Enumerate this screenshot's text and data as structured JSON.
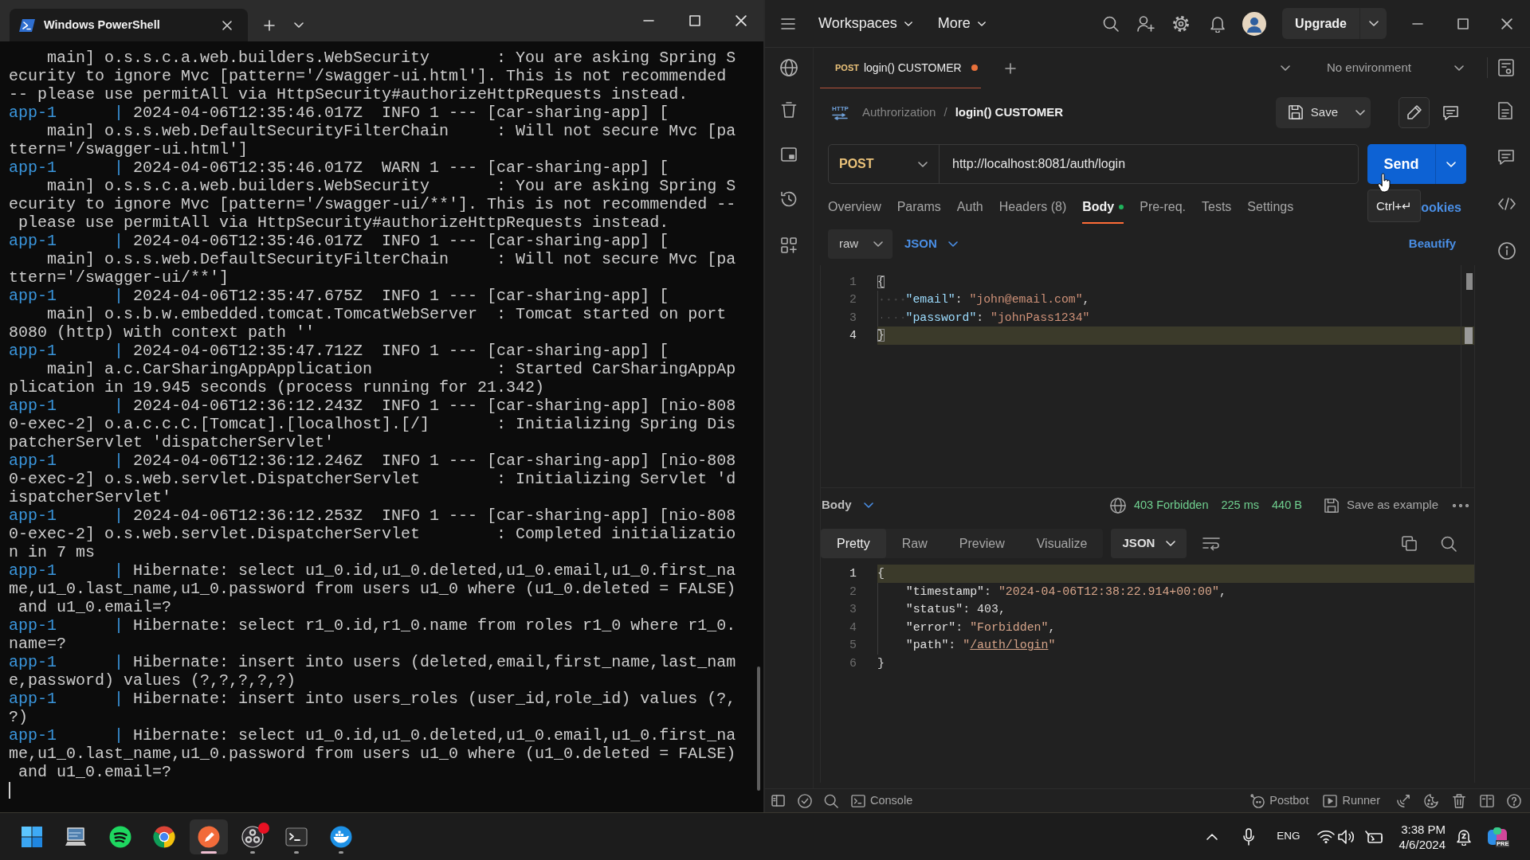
{
  "terminal": {
    "tab_title": "Windows PowerShell",
    "lines": [
      {
        "kind": "wrap",
        "text": "    main] o.s.s.c.a.web.builders.WebSecurity       : You are asking Spring S"
      },
      {
        "kind": "wrap",
        "text": "ecurity to ignore Mvc [pattern='/swagger-ui.html']. This is not recommended"
      },
      {
        "kind": "wrap",
        "text": "-- please use permitAll via HttpSecurity#authorizeHttpRequests instead."
      },
      {
        "kind": "log",
        "prefix": "app-1      |",
        "text": "2024-04-06T12:35:46.017Z  INFO 1 --- [car-sharing-app] ["
      },
      {
        "kind": "wrap",
        "text": "    main] o.s.s.web.DefaultSecurityFilterChain     : Will not secure Mvc [pa"
      },
      {
        "kind": "wrap",
        "text": "ttern='/swagger-ui.html']"
      },
      {
        "kind": "log",
        "prefix": "app-1      |",
        "text": "2024-04-06T12:35:46.017Z  WARN 1 --- [car-sharing-app] ["
      },
      {
        "kind": "wrap",
        "text": "    main] o.s.s.c.a.web.builders.WebSecurity       : You are asking Spring S"
      },
      {
        "kind": "wrap",
        "text": "ecurity to ignore Mvc [pattern='/swagger-ui/**']. This is not recommended --"
      },
      {
        "kind": "wrap",
        "text": " please use permitAll via HttpSecurity#authorizeHttpRequests instead."
      },
      {
        "kind": "log",
        "prefix": "app-1      |",
        "text": "2024-04-06T12:35:46.017Z  INFO 1 --- [car-sharing-app] ["
      },
      {
        "kind": "wrap",
        "text": "    main] o.s.s.web.DefaultSecurityFilterChain     : Will not secure Mvc [pa"
      },
      {
        "kind": "wrap",
        "text": "ttern='/swagger-ui/**']"
      },
      {
        "kind": "log",
        "prefix": "app-1      |",
        "text": "2024-04-06T12:35:47.675Z  INFO 1 --- [car-sharing-app] ["
      },
      {
        "kind": "wrap",
        "text": "    main] o.s.b.w.embedded.tomcat.TomcatWebServer  : Tomcat started on port"
      },
      {
        "kind": "wrap",
        "text": "8080 (http) with context path ''"
      },
      {
        "kind": "log",
        "prefix": "app-1      |",
        "text": "2024-04-06T12:35:47.712Z  INFO 1 --- [car-sharing-app] ["
      },
      {
        "kind": "wrap",
        "text": "    main] a.c.CarSharingAppApplication             : Started CarSharingAppAp"
      },
      {
        "kind": "wrap",
        "text": "plication in 19.945 seconds (process running for 21.342)"
      },
      {
        "kind": "log",
        "prefix": "app-1      |",
        "text": "2024-04-06T12:36:12.243Z  INFO 1 --- [car-sharing-app] [nio-808"
      },
      {
        "kind": "wrap",
        "text": "0-exec-2] o.a.c.c.C.[Tomcat].[localhost].[/]       : Initializing Spring Dis"
      },
      {
        "kind": "wrap",
        "text": "patcherServlet 'dispatcherServlet'"
      },
      {
        "kind": "log",
        "prefix": "app-1      |",
        "text": "2024-04-06T12:36:12.246Z  INFO 1 --- [car-sharing-app] [nio-808"
      },
      {
        "kind": "wrap",
        "text": "0-exec-2] o.s.web.servlet.DispatcherServlet        : Initializing Servlet 'd"
      },
      {
        "kind": "wrap",
        "text": "ispatcherServlet'"
      },
      {
        "kind": "log",
        "prefix": "app-1      |",
        "text": "2024-04-06T12:36:12.253Z  INFO 1 --- [car-sharing-app] [nio-808"
      },
      {
        "kind": "wrap",
        "text": "0-exec-2] o.s.web.servlet.DispatcherServlet        : Completed initializatio"
      },
      {
        "kind": "wrap",
        "text": "n in 7 ms"
      },
      {
        "kind": "log",
        "prefix": "app-1      |",
        "text": "Hibernate: select u1_0.id,u1_0.deleted,u1_0.email,u1_0.first_na"
      },
      {
        "kind": "wrap",
        "text": "me,u1_0.last_name,u1_0.password from users u1_0 where (u1_0.deleted = FALSE)"
      },
      {
        "kind": "wrap",
        "text": " and u1_0.email=?"
      },
      {
        "kind": "log",
        "prefix": "app-1      |",
        "text": "Hibernate: select r1_0.id,r1_0.name from roles r1_0 where r1_0."
      },
      {
        "kind": "wrap",
        "text": "name=?"
      },
      {
        "kind": "log",
        "prefix": "app-1      |",
        "text": "Hibernate: insert into users (deleted,email,first_name,last_nam"
      },
      {
        "kind": "wrap",
        "text": "e,password) values (?,?,?,?,?)"
      },
      {
        "kind": "log",
        "prefix": "app-1      |",
        "text": "Hibernate: insert into users_roles (user_id,role_id) values (?,"
      },
      {
        "kind": "wrap",
        "text": "?)"
      },
      {
        "kind": "log",
        "prefix": "app-1      |",
        "text": "Hibernate: select u1_0.id,u1_0.deleted,u1_0.email,u1_0.first_na"
      },
      {
        "kind": "wrap",
        "text": "me,u1_0.last_name,u1_0.password from users u1_0 where (u1_0.deleted = FALSE)"
      },
      {
        "kind": "wrap",
        "text": " and u1_0.email=?"
      }
    ]
  },
  "postman": {
    "header": {
      "menus": [
        "Workspaces",
        "More"
      ],
      "upgrade": "Upgrade"
    },
    "tabs": [
      {
        "method": "POST",
        "title": "login() CUSTOMER",
        "unsaved": true,
        "selected": true
      }
    ],
    "environment": "No environment",
    "breadcrumb": {
      "icon_label": "HTTP",
      "collection": "Authrorization",
      "separator": "/",
      "request": "login() CUSTOMER"
    },
    "save": "Save",
    "request": {
      "method": "POST",
      "url": "http://localhost:8081/auth/login",
      "send": "Send",
      "tooltip": "Ctrl+↵"
    },
    "sections": [
      {
        "label": "Overview",
        "selected": false,
        "has_content": false
      },
      {
        "label": "Params",
        "selected": false,
        "has_content": false
      },
      {
        "label": "Auth",
        "selected": false,
        "has_content": false
      },
      {
        "label": "Headers (8)",
        "selected": false,
        "has_content": false
      },
      {
        "label": "Body",
        "selected": true,
        "has_content": true
      },
      {
        "label": "Pre-req.",
        "selected": false,
        "has_content": false
      },
      {
        "label": "Tests",
        "selected": false,
        "has_content": false
      },
      {
        "label": "Settings",
        "selected": false,
        "has_content": false
      }
    ],
    "cookies": "ookies",
    "body_mode": "raw",
    "body_format": "JSON",
    "beautify": "Beautify",
    "request_body": {
      "show_whitespace": true,
      "lines": [
        {
          "number": "1",
          "indented": false,
          "current": false,
          "tokens": [
            {
              "kind": "matched_bracket",
              "text": "{"
            }
          ]
        },
        {
          "number": "2",
          "indented": true,
          "current": false,
          "tokens": [
            {
              "kind": "key",
              "text": "\"email\""
            },
            {
              "kind": "punct",
              "text": ": "
            },
            {
              "kind": "string",
              "text": "\"john@email.com\""
            },
            {
              "kind": "punct",
              "text": ","
            }
          ]
        },
        {
          "number": "3",
          "indented": true,
          "current": false,
          "tokens": [
            {
              "kind": "key",
              "text": "\"password\""
            },
            {
              "kind": "punct",
              "text": ": "
            },
            {
              "kind": "string",
              "text": "\"johnPass1234\""
            }
          ]
        },
        {
          "number": "4",
          "indented": false,
          "current": true,
          "tokens": [
            {
              "kind": "matched_bracket",
              "text": "}"
            }
          ]
        }
      ]
    },
    "response": {
      "label": "Body",
      "status": "403 Forbidden",
      "time": "225 ms",
      "size": "440 B",
      "save_example": "Save as example",
      "views": [
        {
          "label": "Pretty",
          "selected": true
        },
        {
          "label": "Raw",
          "selected": false
        },
        {
          "label": "Preview",
          "selected": false
        },
        {
          "label": "Visualize",
          "selected": false
        }
      ],
      "format": "JSON",
      "body": {
        "show_whitespace": false,
        "lines": [
          {
            "number": "1",
            "indented": false,
            "current": true,
            "tokens": [
              {
                "kind": "punct",
                "text": "{"
              }
            ]
          },
          {
            "number": "2",
            "indented": true,
            "current": false,
            "tokens": [
              {
                "kind": "key",
                "text": "\"timestamp\""
              },
              {
                "kind": "punct",
                "text": ": "
              },
              {
                "kind": "string",
                "text": "\"2024-04-06T12:38:22.914+00:00\""
              },
              {
                "kind": "punct",
                "text": ","
              }
            ]
          },
          {
            "number": "3",
            "indented": true,
            "current": false,
            "tokens": [
              {
                "kind": "key",
                "text": "\"status\""
              },
              {
                "kind": "punct",
                "text": ": "
              },
              {
                "kind": "number",
                "text": "403"
              },
              {
                "kind": "punct",
                "text": ","
              }
            ]
          },
          {
            "number": "4",
            "indented": true,
            "current": false,
            "tokens": [
              {
                "kind": "key",
                "text": "\"error\""
              },
              {
                "kind": "punct",
                "text": ": "
              },
              {
                "kind": "string",
                "text": "\"Forbidden\""
              },
              {
                "kind": "punct",
                "text": ","
              }
            ]
          },
          {
            "number": "5",
            "indented": true,
            "current": false,
            "tokens": [
              {
                "kind": "key",
                "text": "\"path\""
              },
              {
                "kind": "punct",
                "text": ": "
              },
              {
                "kind": "string",
                "text": "\""
              },
              {
                "kind": "link",
                "text": "/auth/login"
              },
              {
                "kind": "string",
                "text": "\""
              }
            ]
          },
          {
            "number": "6",
            "indented": false,
            "current": false,
            "tokens": [
              {
                "kind": "punct",
                "text": "}"
              }
            ]
          }
        ]
      }
    },
    "status_bar": {
      "console": "Console",
      "postbot": "Postbot",
      "runner": "Runner"
    }
  },
  "taskbar": {
    "apps": [
      {
        "kind": "start",
        "running": false,
        "selected": false,
        "notification": false
      },
      {
        "kind": "computer",
        "running": false,
        "selected": false,
        "notification": false
      },
      {
        "kind": "music",
        "running": false,
        "selected": false,
        "notification": false
      },
      {
        "kind": "browser",
        "running": false,
        "selected": false,
        "notification": false
      },
      {
        "kind": "api_client",
        "running": true,
        "selected": true,
        "notification": false
      },
      {
        "kind": "recorder",
        "running": true,
        "selected": false,
        "notification": true
      },
      {
        "kind": "terminal",
        "running": true,
        "selected": false,
        "notification": false
      },
      {
        "kind": "containers",
        "running": true,
        "selected": false,
        "notification": false
      }
    ],
    "language": "ENG",
    "time": "3:38 PM",
    "date": "4/6/2024",
    "copilot_badge": "PRE"
  }
}
